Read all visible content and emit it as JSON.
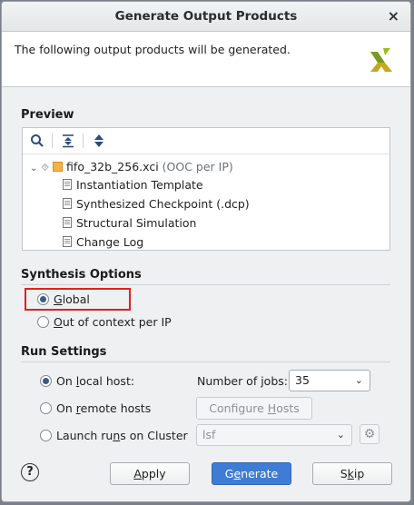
{
  "dialog": {
    "title": "Generate Output Products",
    "close": "×",
    "description": "The following output products will be generated."
  },
  "preview": {
    "label": "Preview",
    "tree": {
      "root_name": "fifo_32b_256.xci",
      "root_note": "(OOC per IP)",
      "children": [
        "Instantiation Template",
        "Synthesized Checkpoint (.dcp)",
        "Structural Simulation",
        "Change Log"
      ]
    }
  },
  "synthesis": {
    "label": "Synthesis Options",
    "options": [
      {
        "pre": "",
        "mnemonic": "G",
        "post": "lobal",
        "selected": true
      },
      {
        "pre": "",
        "mnemonic": "O",
        "post": "ut of context per IP",
        "selected": false
      }
    ]
  },
  "run": {
    "label": "Run Settings",
    "local": {
      "pre": "On ",
      "mnemonic": "l",
      "post": "ocal host:",
      "selected": true
    },
    "remote": {
      "pre": "On ",
      "mnemonic": "r",
      "post": "emote hosts",
      "selected": false
    },
    "cluster": {
      "pre": "Launch ru",
      "mnemonic": "n",
      "post": "s on Cluster",
      "selected": false
    },
    "jobs_label": "Number of jobs:",
    "jobs_value": "35",
    "configure_hosts": {
      "pre": "Configure ",
      "mnemonic": "H",
      "post": "osts"
    },
    "cluster_value": "lsf"
  },
  "buttons": {
    "help": "?",
    "apply": {
      "pre": "",
      "mnemonic": "A",
      "post": "pply"
    },
    "generate": {
      "pre": "G",
      "mnemonic": "e",
      "post": "nerate"
    },
    "skip": {
      "pre": "S",
      "mnemonic": "k",
      "post": "ip"
    }
  },
  "colors": {
    "accent": "#3f7cd6",
    "highlight": "#e0201f",
    "logo": "#7a9a1f"
  }
}
